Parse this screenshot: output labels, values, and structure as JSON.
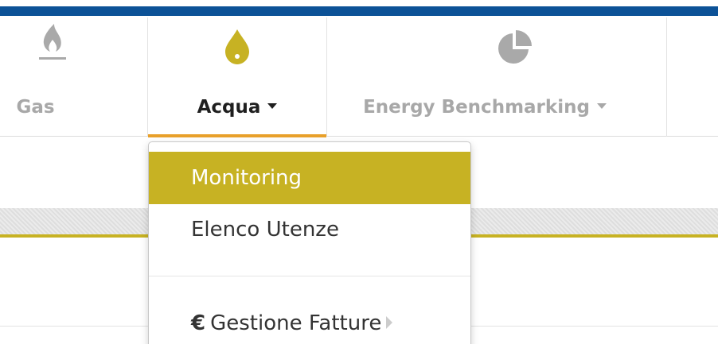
{
  "colors": {
    "top_stripe": "#0c5297",
    "accent_gold": "#c7b223",
    "active_underline": "#e8a02a",
    "inactive_text": "#a8a8a8"
  },
  "nav": {
    "items": [
      {
        "label": "Gas",
        "icon": "flame-icon",
        "state": "inactive"
      },
      {
        "label": "Acqua",
        "icon": "water-drop-icon",
        "state": "active",
        "has_dropdown": true
      },
      {
        "label": "Energy Benchmarking",
        "icon": "pie-chart-icon",
        "state": "inactive",
        "has_dropdown": true
      }
    ]
  },
  "dropdown": {
    "items": [
      {
        "label": "Monitoring",
        "state": "highlighted"
      },
      {
        "label": "Elenco Utenze"
      },
      {
        "prefix": "€",
        "label": "Gestione Fatture",
        "has_submenu": true
      }
    ]
  }
}
